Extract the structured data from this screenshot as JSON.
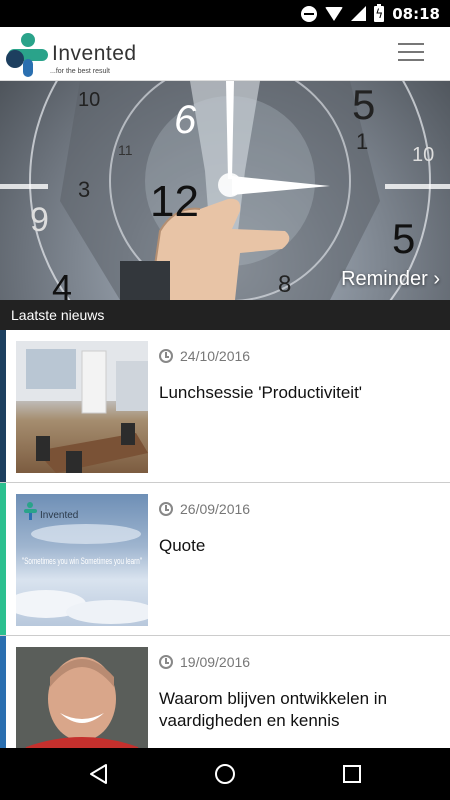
{
  "status_bar": {
    "time": "08:18"
  },
  "app": {
    "brand": "Invented",
    "tagline": "...for the best result"
  },
  "hero": {
    "link_label": "Reminder ›",
    "clock_numbers": [
      "12",
      "6",
      "5",
      "3",
      "10",
      "8",
      "5",
      "4",
      "11",
      "1",
      "9",
      "10"
    ]
  },
  "section": {
    "title": "Laatste nieuws"
  },
  "news": [
    {
      "date": "24/10/2016",
      "title": "Lunchsessie 'Productiviteit'",
      "accent": "#1d3f5f"
    },
    {
      "date": "26/09/2016",
      "title": "Quote",
      "accent": "#2bbf8f",
      "thumb_logo": "Invented",
      "thumb_text": "\"Sometimes you win Sometimes you learn\""
    },
    {
      "date": "19/09/2016",
      "title": "Waarom blijven ontwikkelen in vaardigheden en kennis",
      "accent": "#2a6fb0"
    }
  ],
  "colors": {
    "brand_teal": "#2aa38a",
    "brand_navy": "#1d3f5f",
    "brand_blue": "#2a6fb0"
  }
}
